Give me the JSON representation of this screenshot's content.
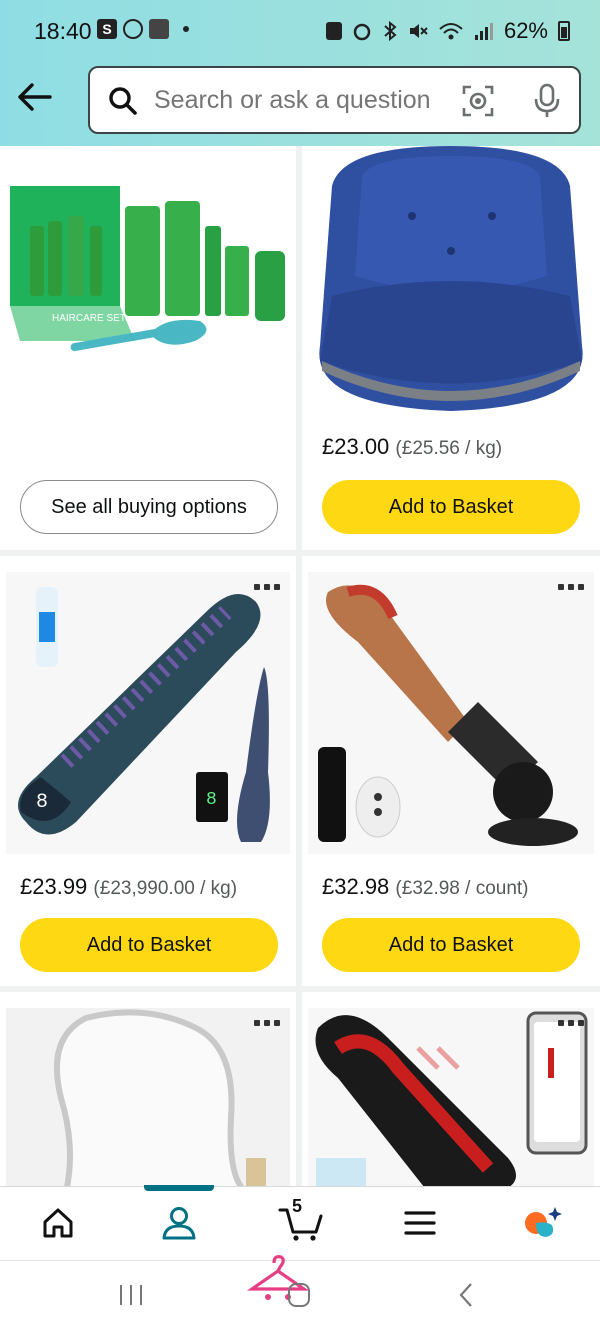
{
  "status_bar": {
    "time": "18:40",
    "left_icons": [
      "s-app-icon",
      "whatsapp-icon",
      "gallery-icon"
    ],
    "battery": "62%"
  },
  "search": {
    "placeholder": "Search or ask a question"
  },
  "products": [
    {
      "image": "haircare-set-product-image",
      "image_text": "HAIRCARE SET",
      "price": "",
      "unit_price": "",
      "button": "See all buying options",
      "button_style": "outline"
    },
    {
      "image": "seat-cushion-product-image",
      "price": "£23.00",
      "unit_price": "(£25.56 / kg)",
      "button": "Add to Basket",
      "button_style": "yellow"
    },
    {
      "image": "tentacle-toy-product-image",
      "price": "£23.99",
      "unit_price": "(£23,990.00 / kg)",
      "button": "Add to Basket",
      "button_style": "yellow"
    },
    {
      "image": "thrusting-device-product-image",
      "price": "£32.98",
      "unit_price": "(£32.98 / count)",
      "button": "Add to Basket",
      "button_style": "yellow"
    },
    {
      "image": "mirror-product-image"
    },
    {
      "image": "red-toy-product-image"
    }
  ],
  "bottom_nav": {
    "items": [
      "home-icon",
      "account-icon",
      "cart-icon",
      "menu-icon",
      "rufus-icon"
    ],
    "active": "account-icon",
    "cart_count": "5"
  },
  "colors": {
    "header_gradient_start": "#8fdde4",
    "header_gradient_end": "#a5e3d9",
    "button_yellow": "#ffd814",
    "active_teal": "#007185",
    "rufus_orange": "#ff6b21"
  }
}
